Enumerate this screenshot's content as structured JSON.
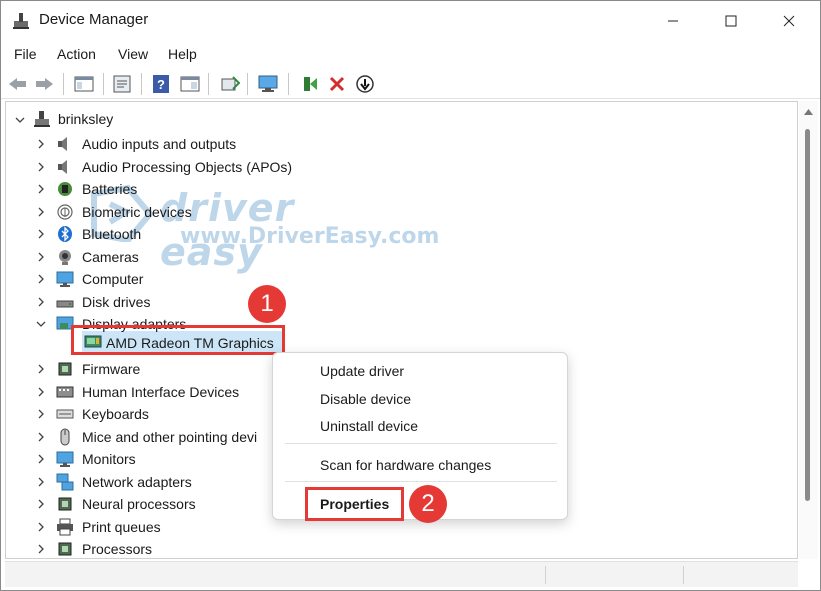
{
  "window": {
    "title": "Device Manager"
  },
  "menu": [
    "File",
    "Action",
    "View",
    "Help"
  ],
  "watermark": {
    "brand": "driver easy",
    "url": "www.DriverEasy.com"
  },
  "tree": {
    "root": "brinksley",
    "categories": [
      {
        "label": "Audio inputs and outputs",
        "icon": "speaker-icon"
      },
      {
        "label": "Audio Processing Objects (APOs)",
        "icon": "speaker-icon"
      },
      {
        "label": "Batteries",
        "icon": "battery-icon"
      },
      {
        "label": "Biometric devices",
        "icon": "fingerprint-icon"
      },
      {
        "label": "Bluetooth",
        "icon": "bluetooth-icon"
      },
      {
        "label": "Cameras",
        "icon": "camera-icon"
      },
      {
        "label": "Computer",
        "icon": "monitor-icon"
      },
      {
        "label": "Disk drives",
        "icon": "disk-icon"
      },
      {
        "label": "Display adapters",
        "icon": "display-adapter-icon",
        "expanded": true
      },
      {
        "label": "Firmware",
        "icon": "chip-icon"
      },
      {
        "label": "Human Interface Devices",
        "icon": "hid-icon"
      },
      {
        "label": "Keyboards",
        "icon": "keyboard-icon"
      },
      {
        "label": "Mice and other pointing devi",
        "icon": "mouse-icon"
      },
      {
        "label": "Monitors",
        "icon": "monitor-icon"
      },
      {
        "label": "Network adapters",
        "icon": "network-icon"
      },
      {
        "label": "Neural processors",
        "icon": "chip-icon"
      },
      {
        "label": "Print queues",
        "icon": "printer-icon"
      },
      {
        "label": "Processors",
        "icon": "chip-icon"
      }
    ],
    "selected_child": "AMD Radeon TM Graphics"
  },
  "context_menu": {
    "items": [
      "Update driver",
      "Disable device",
      "Uninstall device",
      "Scan for hardware changes",
      "Properties"
    ]
  },
  "callouts": {
    "one": "1",
    "two": "2"
  },
  "colors": {
    "highlight": "#e53935",
    "selection": "#cde6f7",
    "accent": "#1b6fb3"
  }
}
